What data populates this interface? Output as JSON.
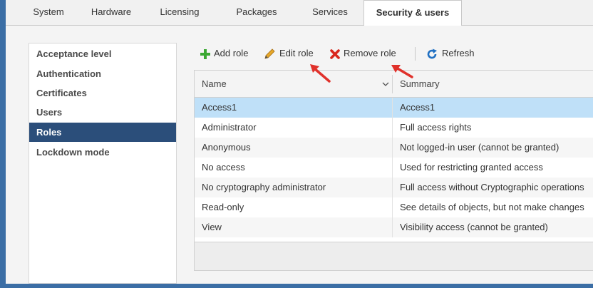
{
  "tabs": [
    {
      "label": "System"
    },
    {
      "label": "Hardware"
    },
    {
      "label": "Licensing"
    },
    {
      "label": "Packages"
    },
    {
      "label": "Services"
    },
    {
      "label": "Security & users"
    }
  ],
  "active_tab": "Security & users",
  "sidebar": {
    "items": [
      {
        "label": "Acceptance level"
      },
      {
        "label": "Authentication"
      },
      {
        "label": "Certificates"
      },
      {
        "label": "Users"
      },
      {
        "label": "Roles"
      },
      {
        "label": "Lockdown mode"
      }
    ],
    "selected": "Roles"
  },
  "toolbar": {
    "add_label": "Add role",
    "edit_label": "Edit role",
    "remove_label": "Remove role",
    "refresh_label": "Refresh",
    "colors": {
      "add": "#3aa832",
      "edit": "#d99a1c",
      "remove": "#d9261c",
      "refresh": "#1f6fc2"
    }
  },
  "grid": {
    "columns": [
      "Name",
      "Summary"
    ],
    "rows": [
      {
        "name": "Access1",
        "summary": "Access1"
      },
      {
        "name": "Administrator",
        "summary": "Full access rights"
      },
      {
        "name": "Anonymous",
        "summary": "Not logged-in user (cannot be granted)"
      },
      {
        "name": "No access",
        "summary": "Used for restricting granted access"
      },
      {
        "name": "No cryptography administrator",
        "summary": "Full access without Cryptographic operations"
      },
      {
        "name": "Read-only",
        "summary": "See details of objects, but not make changes"
      },
      {
        "name": "View",
        "summary": "Visibility access (cannot be granted)"
      }
    ],
    "selected_row": "Access1"
  },
  "annotation_color": "#e0312b"
}
